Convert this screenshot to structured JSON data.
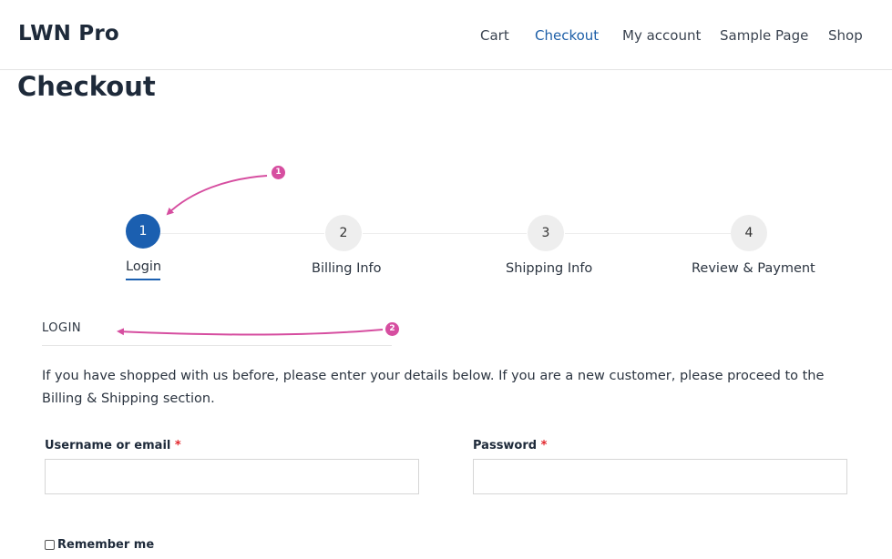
{
  "header": {
    "site_title": "LWN Pro",
    "nav": [
      {
        "label": "Cart"
      },
      {
        "label": "Checkout"
      },
      {
        "label": "My account"
      },
      {
        "label": "Sample Page"
      },
      {
        "label": "Shop"
      }
    ],
    "active_nav": "Checkout"
  },
  "page": {
    "title": "Checkout"
  },
  "steps": [
    {
      "number": "1",
      "label": "Login",
      "active": true
    },
    {
      "number": "2",
      "label": "Billing Info",
      "active": false
    },
    {
      "number": "3",
      "label": "Shipping Info",
      "active": false
    },
    {
      "number": "4",
      "label": "Review & Payment",
      "active": false
    }
  ],
  "login": {
    "heading": "LOGIN",
    "intro": "If you have shopped with us before, please enter your details below. If you are a new customer, please proceed to the Billing & Shipping section.",
    "username_label": "Username or email",
    "password_label": "Password",
    "required_mark": "*",
    "username_value": "",
    "password_value": "",
    "remember_label": "Remember me",
    "remember_checked": false
  },
  "annotations": [
    {
      "number": "1"
    },
    {
      "number": "2"
    }
  ],
  "colors": {
    "accent": "#1b5fb0",
    "annotation": "#d64ea0",
    "required": "#e2262c"
  }
}
